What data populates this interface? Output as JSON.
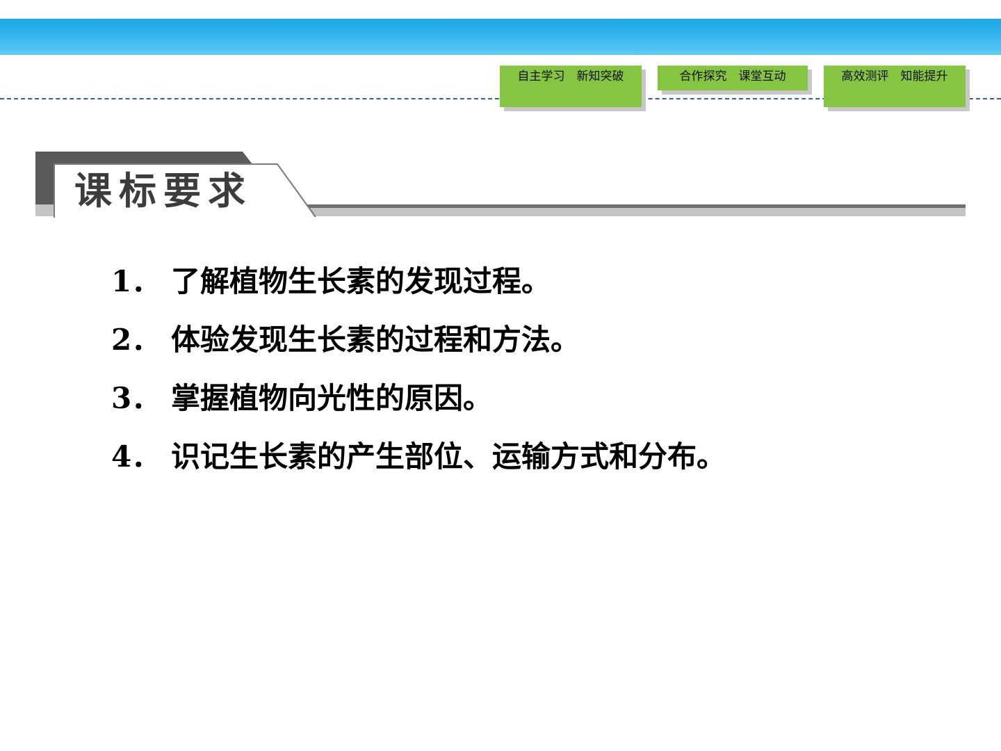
{
  "nav": {
    "items": [
      {
        "label": "自主学习　新知突破"
      },
      {
        "label": "合作探究　课堂互动"
      },
      {
        "label": "高效测评　知能提升"
      }
    ]
  },
  "section": {
    "title": "课标要求"
  },
  "requirements": [
    {
      "num": "1．",
      "text": "了解植物生长素的发现过程。"
    },
    {
      "num": "2．",
      "text": "体验发现生长素的过程和方法。"
    },
    {
      "num": "3．",
      "text": "掌握植物向光性的原因。"
    },
    {
      "num": "4．",
      "text": "识记生长素的产生部位、运输方式和分布。"
    }
  ]
}
